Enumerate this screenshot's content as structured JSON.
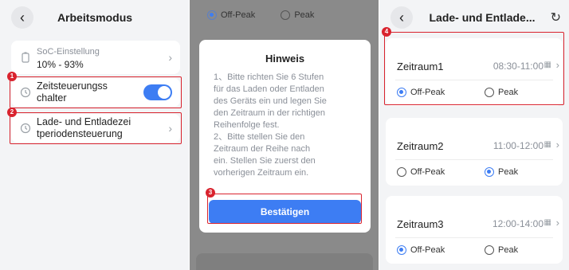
{
  "left_panel": {
    "title": "Arbeitsmodus",
    "soc": {
      "label": "SoC-Einstellung",
      "value": "10% - 93%"
    },
    "scheduler": {
      "line1": "Zeitsteuerungss",
      "line2": "chalter",
      "enabled": true
    },
    "charge_period": {
      "line1": "Lade- und Entladezei",
      "line2": "tperiodensteuerung"
    }
  },
  "middle_panel": {
    "bg_radio": {
      "off_peak": "Off-Peak",
      "peak": "Peak"
    },
    "dialog": {
      "title": "Hinweis",
      "lines": [
        "1、Bitte richten Sie 6 Stufen",
        "für das Laden oder Entladen",
        "des Geräts ein und legen Sie",
        "den Zeitraum in der richtigen",
        "Reihenfolge fest.",
        "2、Bitte stellen Sie den",
        "Zeitraum der Reihe nach",
        "ein. Stellen Sie zuerst den",
        "vorherigen Zeitraum ein."
      ],
      "confirm": "Bestätigen"
    }
  },
  "right_panel": {
    "title": "Lade- und Entlade...",
    "periods": [
      {
        "name": "Zeitraum1",
        "time": "08:30-11:00",
        "selected": "Off-Peak"
      },
      {
        "name": "Zeitraum2",
        "time": "11:00-12:00",
        "selected": "Peak"
      },
      {
        "name": "Zeitraum3",
        "time": "12:00-14:00",
        "selected": "Off-Peak"
      }
    ],
    "off_peak": "Off-Peak",
    "peak": "Peak"
  },
  "badges": [
    "1",
    "2",
    "3",
    "4"
  ],
  "colors": {
    "accent": "#3d7df3",
    "highlight": "#d9232e"
  }
}
